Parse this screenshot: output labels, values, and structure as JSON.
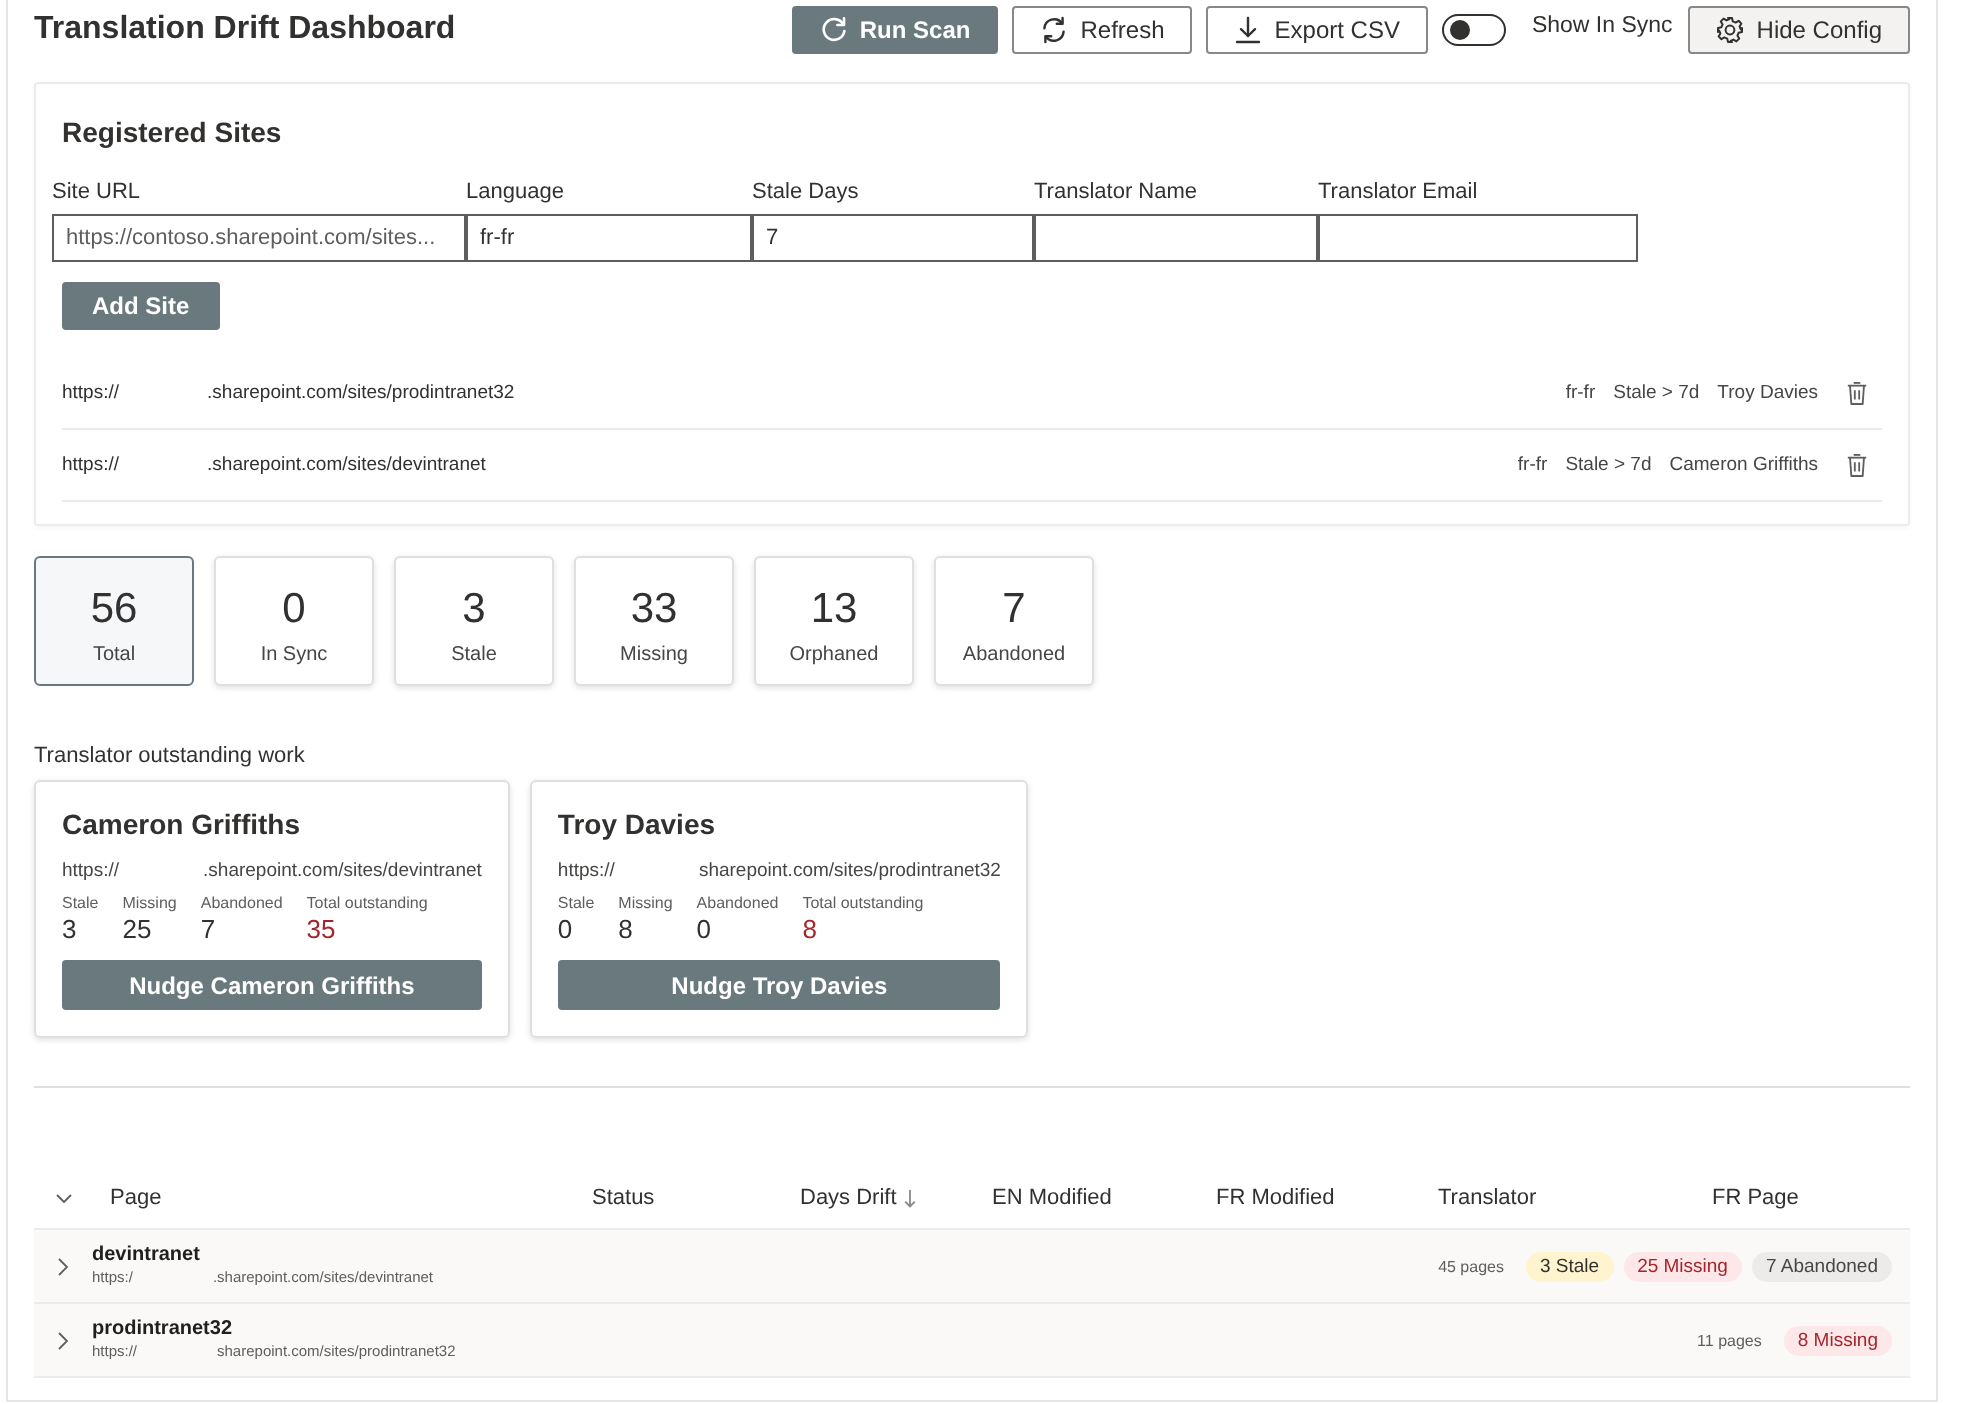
{
  "header": {
    "title": "Translation Drift Dashboard",
    "buttons": [
      {
        "label": "Run Scan",
        "kind": "scan"
      },
      {
        "label": "Refresh",
        "kind": "refresh"
      },
      {
        "label": "Export CSV",
        "kind": "export"
      }
    ],
    "toggle": {
      "label": "Show In Sync",
      "on": false
    },
    "config_button": {
      "label": "Hide Config"
    }
  },
  "registered_sites": {
    "title": "Registered Sites",
    "fields": [
      {
        "label": "Site URL",
        "placeholder": "https://contoso.sharepoint.com/sites..."
      },
      {
        "label": "Language",
        "value": "fr-fr"
      },
      {
        "label": "Stale Days",
        "value": "7"
      },
      {
        "label": "Translator Name"
      },
      {
        "label": "Translator Email"
      }
    ],
    "add_button": "Add Site",
    "sites": [
      {
        "url_prefix": "https://",
        "url_suffix": ".sharepoint.com/sites/prodintranet32",
        "language": "fr-fr",
        "stale_rule": "Stale > 7d",
        "translator": "Troy Davies"
      },
      {
        "url_prefix": "https://",
        "url_suffix": ".sharepoint.com/sites/devintranet",
        "language": "fr-fr",
        "stale_rule": "Stale > 7d",
        "translator": "Cameron Griffiths"
      }
    ]
  },
  "stats": [
    {
      "value": "56",
      "label": "Total",
      "selected": true
    },
    {
      "value": "0",
      "label": "In Sync",
      "selected": false
    },
    {
      "value": "3",
      "label": "Stale",
      "selected": false
    },
    {
      "value": "33",
      "label": "Missing",
      "selected": false
    },
    {
      "value": "13",
      "label": "Orphaned",
      "selected": false
    },
    {
      "value": "7",
      "label": "Abandoned",
      "selected": false
    }
  ],
  "translators": {
    "title": "Translator outstanding work",
    "cards": [
      {
        "name": "Cameron Griffiths",
        "url_prefix": "https://",
        "url_suffix": ".sharepoint.com/sites/devintranet",
        "stats": [
          {
            "label": "Stale",
            "value": "3",
            "kind": "count"
          },
          {
            "label": "Missing",
            "value": "25",
            "kind": "count"
          },
          {
            "label": "Abandoned",
            "value": "7",
            "kind": "count"
          },
          {
            "label": "Total outstanding",
            "value": "35",
            "kind": "total"
          }
        ],
        "button": "Nudge Cameron Griffiths"
      },
      {
        "name": "Troy Davies",
        "url_prefix": "https://",
        "url_suffix": "sharepoint.com/sites/prodintranet32",
        "stats": [
          {
            "label": "Stale",
            "value": "0",
            "kind": "count"
          },
          {
            "label": "Missing",
            "value": "8",
            "kind": "count"
          },
          {
            "label": "Abandoned",
            "value": "0",
            "kind": "count"
          },
          {
            "label": "Total outstanding",
            "value": "8",
            "kind": "total"
          }
        ],
        "button": "Nudge Troy Davies"
      }
    ]
  },
  "table": {
    "columns": [
      {
        "label": "Page",
        "sorted": false
      },
      {
        "label": "Status",
        "sorted": false
      },
      {
        "label": "Days Drift",
        "sorted": true
      },
      {
        "label": "EN Modified",
        "sorted": false
      },
      {
        "label": "FR Modified",
        "sorted": false
      },
      {
        "label": "Translator",
        "sorted": false
      },
      {
        "label": "FR Page",
        "sorted": false
      }
    ],
    "rows": [
      {
        "name": "devintranet",
        "url_prefix": "https:/",
        "url_suffix": ".sharepoint.com/sites/devintranet",
        "expanded": false,
        "page_count": "45 pages",
        "badges": [
          {
            "label": "3 Stale",
            "kind": "stale"
          },
          {
            "label": "25 Missing",
            "kind": "missing"
          },
          {
            "label": "7 Abandoned",
            "kind": "abandoned"
          }
        ]
      },
      {
        "name": "prodintranet32",
        "url_prefix": "https://",
        "url_suffix": "sharepoint.com/sites/prodintranet32",
        "expanded": false,
        "page_count": "11 pages",
        "badges": [
          {
            "label": "8 Missing",
            "kind": "missing"
          }
        ]
      }
    ]
  }
}
